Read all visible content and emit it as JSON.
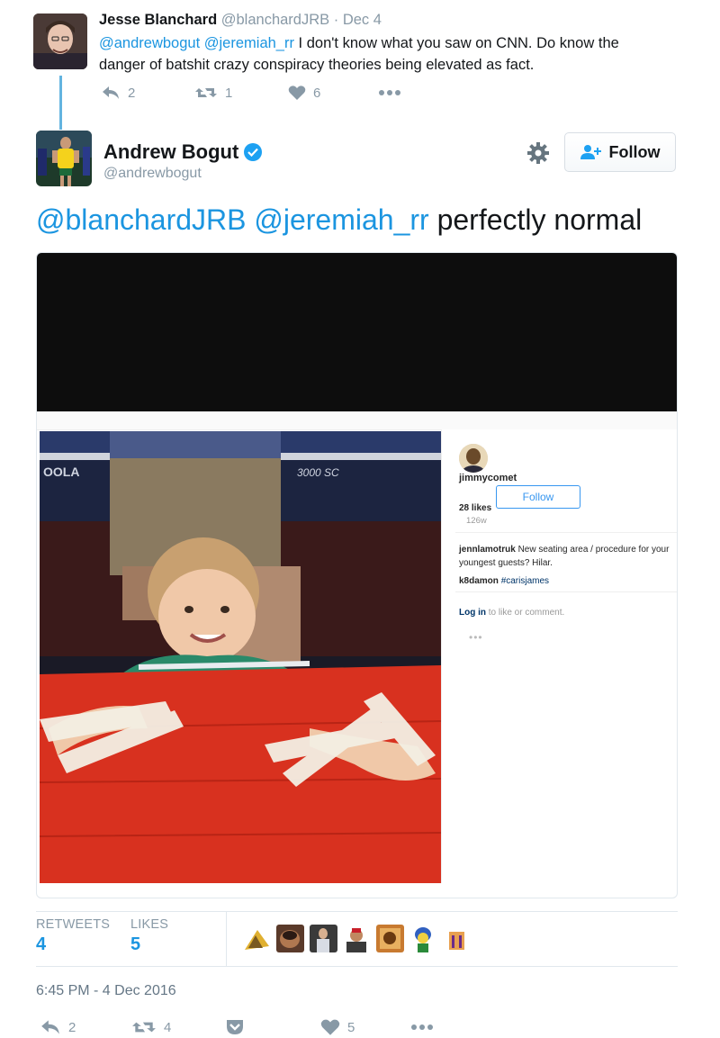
{
  "reply": {
    "name": "Jesse Blanchard",
    "handle": "@blanchardJRB",
    "date_sep": " · ",
    "date": "Dec 4",
    "mention1": "@andrewbogut",
    "mention2": "@jeremiah_rr",
    "text_line1_rest": " I don't know what you saw on CNN. Do know the",
    "text_line2": "danger of batshit crazy conspiracy theories being elevated as fact.",
    "reply_count": "2",
    "retweet_count": "1",
    "like_count": "6"
  },
  "main": {
    "name": "Andrew Bogut",
    "handle": "@andrewbogut",
    "follow_label": "Follow",
    "mention1": "@blanchardJRB",
    "mention2": "@jeremiah_rr",
    "text_rest": " perfectly normal"
  },
  "instagram": {
    "username": "jimmycomet",
    "follow_label": "Follow",
    "likes": "28 likes",
    "age": "126w",
    "commenter1": "jennlamotruk",
    "comment1": "New seating area / procedure for your youngest guests? Hilar.",
    "commenter2": "k8damon",
    "hashtag": "#carisjames",
    "login_link": "Log in",
    "login_rest": " to like or comment.",
    "more": "•••",
    "photo_text_left": "OOLA",
    "photo_text_right": "3000 SC"
  },
  "stats": {
    "retweets_label": "RETWEETS",
    "retweets_value": "4",
    "likes_label": "LIKES",
    "likes_value": "5"
  },
  "timestamp": "6:45 PM - 4 Dec 2016",
  "footer": {
    "reply_count": "2",
    "retweet_count": "4",
    "like_count": "5"
  },
  "colors": {
    "link": "#1b95e0",
    "muted": "#8899a6",
    "thread_line": "#63b4e0",
    "table_red": "#d8311f"
  }
}
